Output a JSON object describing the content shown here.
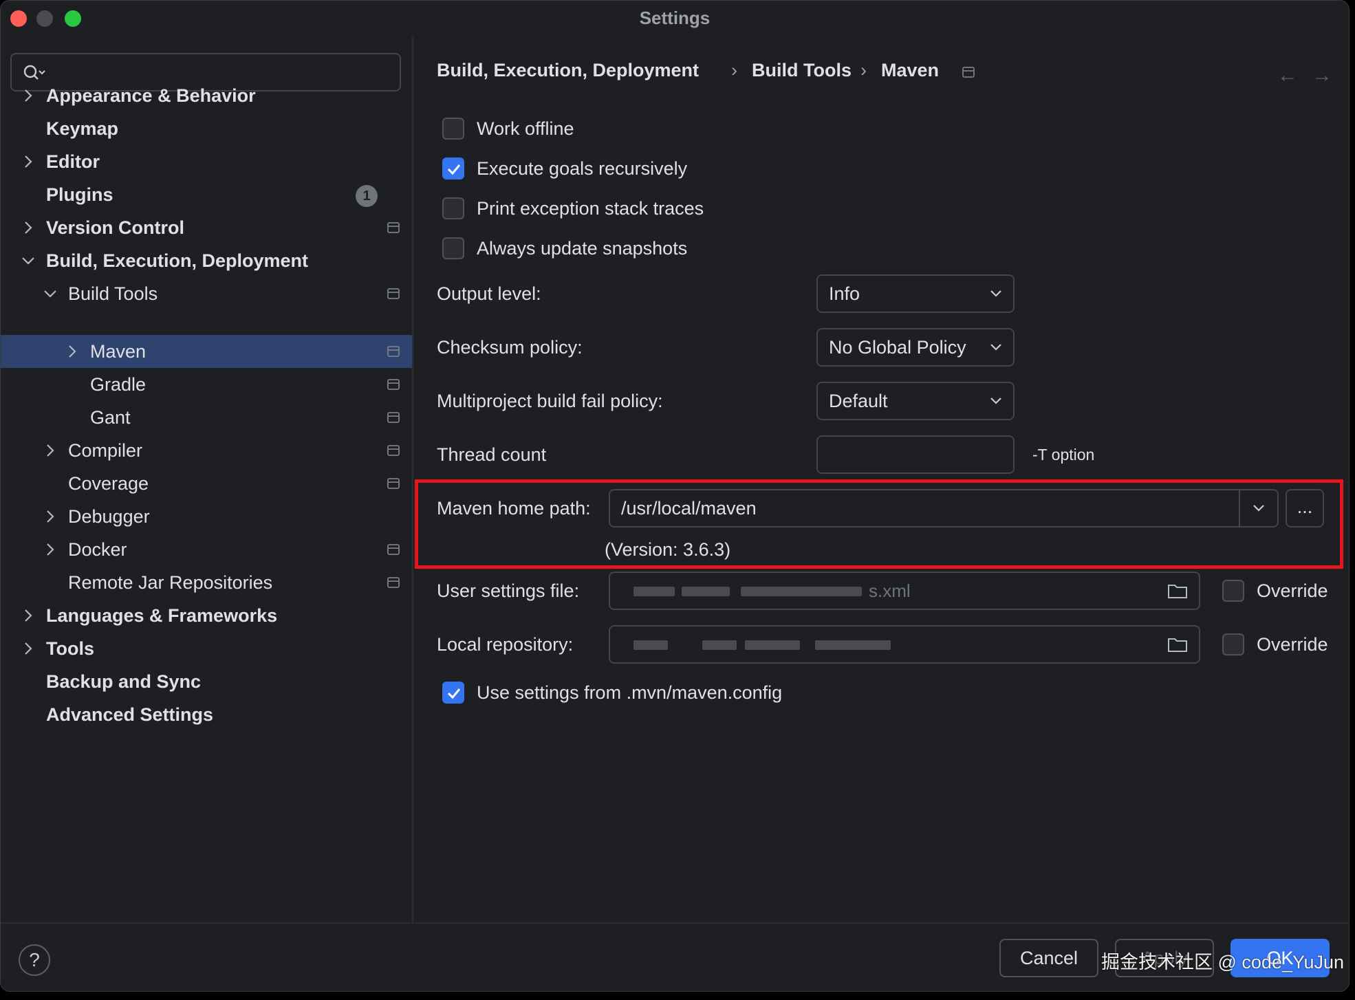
{
  "window": {
    "title": "Settings"
  },
  "sidebar": {
    "search_placeholder": "",
    "items": [
      {
        "label": "Appearance & Behavior"
      },
      {
        "label": "Keymap"
      },
      {
        "label": "Editor"
      },
      {
        "label": "Plugins",
        "badge": "1"
      },
      {
        "label": "Version Control"
      },
      {
        "label": "Build, Execution, Deployment"
      },
      {
        "label": "Build Tools"
      },
      {
        "label": "Maven"
      },
      {
        "label": "Gradle"
      },
      {
        "label": "Gant"
      },
      {
        "label": "Compiler"
      },
      {
        "label": "Coverage"
      },
      {
        "label": "Debugger"
      },
      {
        "label": "Docker"
      },
      {
        "label": "Remote Jar Repositories"
      },
      {
        "label": "Languages & Frameworks"
      },
      {
        "label": "Tools"
      },
      {
        "label": "Backup and Sync"
      },
      {
        "label": "Advanced Settings"
      }
    ]
  },
  "breadcrumb": {
    "part1": "Build, Execution, Deployment",
    "part2": "Build Tools",
    "part3": "Maven",
    "separator": "›"
  },
  "nav": {
    "back": "←",
    "forward": "→"
  },
  "options": {
    "work_offline": "Work offline",
    "execute_goals": "Execute goals recursively",
    "print_exception": "Print exception stack traces",
    "always_update": "Always update snapshots",
    "use_settings": "Use settings from .mvn/maven.config"
  },
  "fields": {
    "output_level_label": "Output level:",
    "output_level_value": "Info",
    "checksum_label": "Checksum policy:",
    "checksum_value": "No Global Policy",
    "multiproject_label": "Multiproject build fail policy:",
    "multiproject_value": "Default",
    "thread_count_label": "Thread count",
    "thread_count_value": "",
    "thread_count_hint": "-T option",
    "maven_home_label": "Maven home path:",
    "maven_home_value": "/usr/local/maven",
    "maven_home_browse": "...",
    "maven_version": "(Version: 3.6.3)",
    "user_settings_label": "User settings file:",
    "user_settings_suffix": "s.xml",
    "local_repo_label": "Local repository:",
    "override_label": "Override"
  },
  "footer": {
    "help": "?",
    "cancel": "Cancel",
    "apply": "Apply",
    "ok": "OK",
    "watermark": "掘金技术社区 @ code_YuJun"
  },
  "colors": {
    "accent": "#3574f0",
    "highlight": "#e8161c",
    "selected": "#2e436e"
  }
}
